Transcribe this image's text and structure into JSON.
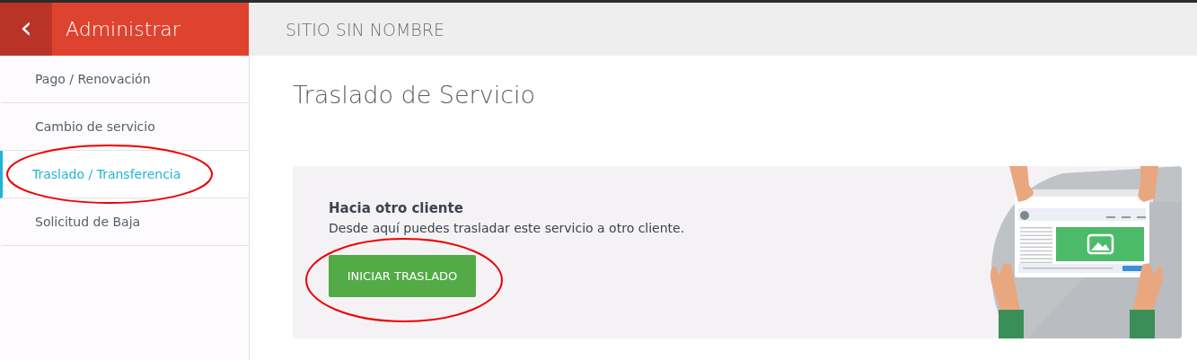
{
  "sidebar": {
    "back": "‹",
    "title": "Administrar",
    "items": [
      {
        "label": "Pago / Renovación",
        "selected": false,
        "circled": false
      },
      {
        "label": "Cambio de servicio",
        "selected": false,
        "circled": false
      },
      {
        "label": "Traslado / Transferencia",
        "selected": true,
        "circled": true
      },
      {
        "label": "Solicitud de Baja",
        "selected": false,
        "circled": false
      }
    ]
  },
  "topbar": {
    "site_name": "SITIO SIN NOMBRE"
  },
  "page": {
    "title": "Traslado de Servicio",
    "card": {
      "heading": "Hacia otro cliente",
      "text": "Desde aquí puedes trasladar este servicio a otro cliente.",
      "button": {
        "label": "INICIAR TRASLADO",
        "circled": true
      }
    }
  }
}
